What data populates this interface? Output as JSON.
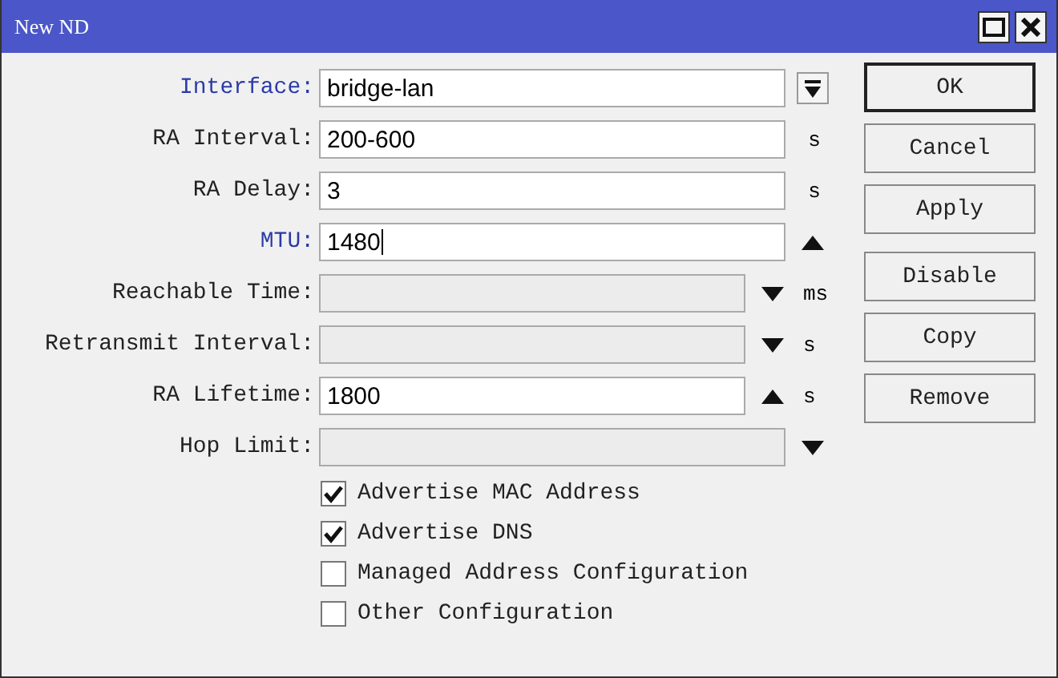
{
  "window": {
    "title": "New ND"
  },
  "rows": [
    {
      "label": "Interface:",
      "highlighted": true,
      "value": "bridge-lan",
      "enabled": true,
      "focused": false,
      "kind": "dropdown"
    },
    {
      "label": "RA Interval:",
      "highlighted": false,
      "value": "200-600",
      "enabled": true,
      "focused": false,
      "kind": "plain",
      "unit": "s"
    },
    {
      "label": "RA Delay:",
      "highlighted": false,
      "value": "3",
      "enabled": true,
      "focused": false,
      "kind": "plain",
      "unit": "s"
    },
    {
      "label": "MTU:",
      "highlighted": true,
      "value": "1480",
      "enabled": true,
      "focused": true,
      "kind": "up"
    },
    {
      "label": "Reachable Time:",
      "highlighted": false,
      "value": "",
      "enabled": false,
      "focused": false,
      "kind": "down",
      "unit": "ms"
    },
    {
      "label": "Retransmit Interval:",
      "highlighted": false,
      "value": "",
      "enabled": false,
      "focused": false,
      "kind": "down",
      "unit": "s"
    },
    {
      "label": "RA Lifetime:",
      "highlighted": false,
      "value": "1800",
      "enabled": true,
      "focused": false,
      "kind": "up",
      "unit": "s"
    },
    {
      "label": "Hop Limit:",
      "highlighted": false,
      "value": "",
      "enabled": false,
      "focused": false,
      "kind": "down"
    }
  ],
  "checkboxes": [
    {
      "label": "Advertise MAC Address",
      "checked": true
    },
    {
      "label": "Advertise DNS",
      "checked": true
    },
    {
      "label": "Managed Address Configuration",
      "checked": false
    },
    {
      "label": "Other Configuration",
      "checked": false
    }
  ],
  "buttons": [
    {
      "label": "OK",
      "default": true
    },
    {
      "label": "Cancel",
      "default": false
    },
    {
      "label": "Apply",
      "default": false
    },
    {
      "label": "Disable",
      "default": false
    },
    {
      "label": "Copy",
      "default": false
    },
    {
      "label": "Remove",
      "default": false
    }
  ]
}
